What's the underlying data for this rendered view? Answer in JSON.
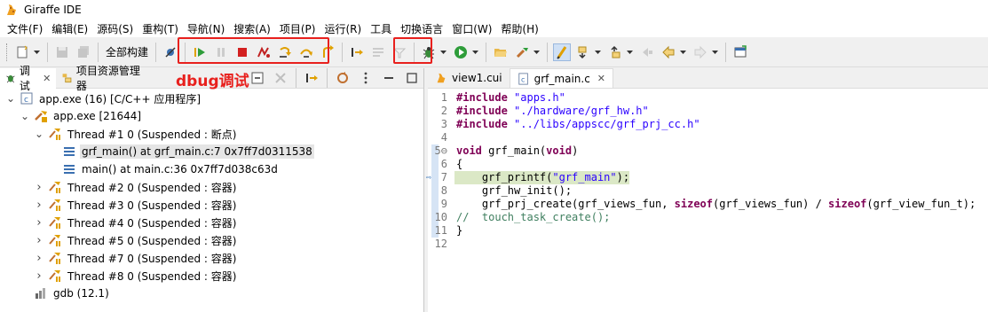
{
  "window": {
    "title": "Giraffe IDE"
  },
  "menubar": [
    "文件(F)",
    "编辑(E)",
    "源码(S)",
    "重构(T)",
    "导航(N)",
    "搜索(A)",
    "项目(P)",
    "运行(R)",
    "工具",
    "切换语言",
    "窗口(W)",
    "帮助(H)"
  ],
  "toolbar": {
    "build_all_label": "全部构建"
  },
  "annotation": {
    "text": "dbug调试"
  },
  "left_panel": {
    "tabs": [
      {
        "label": "调试",
        "icon": "bug-icon",
        "closable": true
      },
      {
        "label": "项目资源管理器",
        "icon": "project-explorer-icon",
        "closable": false
      }
    ],
    "tree": [
      {
        "label": "app.exe  (16)   [C/C++ 应用程序]",
        "indent": 0,
        "expanded": true,
        "icon": "c-app-icon"
      },
      {
        "label": "app.exe [21644]",
        "indent": 1,
        "expanded": true,
        "icon": "process-icon"
      },
      {
        "label": "Thread #1 0 (Suspended : 断点)",
        "indent": 2,
        "expanded": true,
        "icon": "thread-suspended-icon"
      },
      {
        "label": "grf_main() at grf_main.c:7 0x7ff7d0311538",
        "indent": 3,
        "expanded": null,
        "icon": "stack-frame-icon",
        "selected": true
      },
      {
        "label": "main() at main.c:36 0x7ff7d038c63d",
        "indent": 3,
        "expanded": null,
        "icon": "stack-frame-icon"
      },
      {
        "label": "Thread #2 0 (Suspended : 容器)",
        "indent": 2,
        "expanded": false,
        "icon": "thread-suspended-icon"
      },
      {
        "label": "Thread #3 0 (Suspended : 容器)",
        "indent": 2,
        "expanded": false,
        "icon": "thread-suspended-icon"
      },
      {
        "label": "Thread #4 0 (Suspended : 容器)",
        "indent": 2,
        "expanded": false,
        "icon": "thread-suspended-icon"
      },
      {
        "label": "Thread #5 0 (Suspended : 容器)",
        "indent": 2,
        "expanded": false,
        "icon": "thread-suspended-icon"
      },
      {
        "label": "Thread #7 0 (Suspended : 容器)",
        "indent": 2,
        "expanded": false,
        "icon": "thread-suspended-icon"
      },
      {
        "label": "Thread #8 0 (Suspended : 容器)",
        "indent": 2,
        "expanded": false,
        "icon": "thread-suspended-icon"
      },
      {
        "label": "gdb (12.1)",
        "indent": 1,
        "expanded": null,
        "icon": "gdb-icon"
      }
    ]
  },
  "editor": {
    "tabs": [
      {
        "label": "view1.cui",
        "active": false,
        "icon": "cui-file-icon"
      },
      {
        "label": "grf_main.c",
        "active": true,
        "icon": "c-file-icon",
        "closable": true
      }
    ],
    "lines": [
      {
        "n": "1",
        "tokens": [
          [
            "pp",
            "#include"
          ],
          [
            "ph",
            " "
          ],
          [
            "str",
            "\"apps.h\""
          ]
        ]
      },
      {
        "n": "2",
        "tokens": [
          [
            "pp",
            "#include"
          ],
          [
            "ph",
            " "
          ],
          [
            "str",
            "\"./hardware/grf_hw.h\""
          ]
        ]
      },
      {
        "n": "3",
        "tokens": [
          [
            "pp",
            "#include"
          ],
          [
            "ph",
            " "
          ],
          [
            "str",
            "\"../libs/appscc/grf_prj_cc.h\""
          ]
        ]
      },
      {
        "n": "4",
        "tokens": []
      },
      {
        "n": "5⊖",
        "tokens": [
          [
            "kw",
            "void"
          ],
          [
            "ph",
            " grf_main("
          ],
          [
            "kw",
            "void"
          ],
          [
            "ph",
            ")"
          ]
        ]
      },
      {
        "n": "6",
        "tokens": [
          [
            "ph",
            "{"
          ]
        ]
      },
      {
        "n": "7",
        "current": true,
        "tokens": [
          [
            "ph",
            "    grf_printf("
          ],
          [
            "str",
            "\"grf_main\""
          ],
          [
            "ph",
            ");"
          ]
        ]
      },
      {
        "n": "8",
        "tokens": [
          [
            "ph",
            "    grf_hw_init();"
          ]
        ]
      },
      {
        "n": "9",
        "tokens": [
          [
            "ph",
            "    grf_prj_create(grf_views_fun, "
          ],
          [
            "kw",
            "sizeof"
          ],
          [
            "ph",
            "(grf_views_fun) / "
          ],
          [
            "kw",
            "sizeof"
          ],
          [
            "ph",
            "(grf_view_fun_t);"
          ]
        ]
      },
      {
        "n": "10",
        "tokens": [
          [
            "cm",
            "//  touch_task_create();"
          ]
        ]
      },
      {
        "n": "11",
        "tokens": [
          [
            "ph",
            "}"
          ]
        ]
      },
      {
        "n": "12",
        "tokens": []
      }
    ]
  },
  "colors": {
    "highlight_box": "#e8201d",
    "current_line": "#dbe8c6",
    "keyword": "#7f0055",
    "string": "#2a00ff",
    "comment": "#3f7f5f"
  }
}
